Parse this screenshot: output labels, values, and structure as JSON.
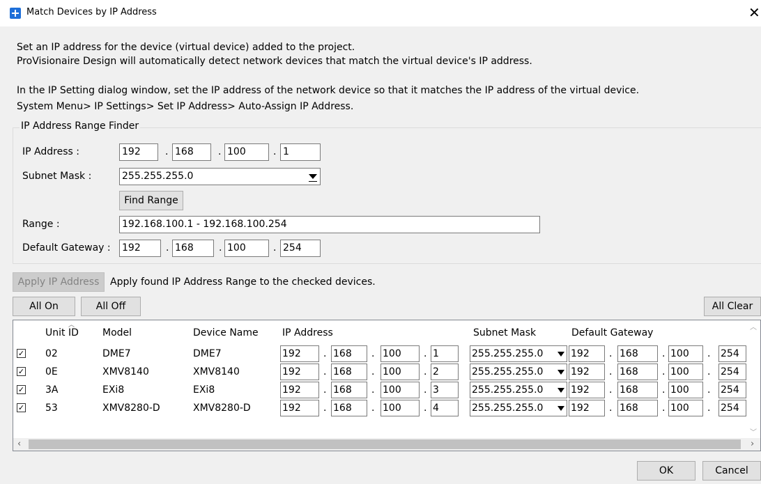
{
  "window": {
    "title": "Match Devices by IP Address",
    "close": "✕"
  },
  "description": {
    "line1": "Set an IP address for the device (virtual device) added to the project.",
    "line2": "ProVisionaire Design will automatically detect network devices that match the virtual device's IP address.",
    "line3": "In the IP Setting dialog window, set the IP address of the network device so that it matches the IP address of the virtual device.",
    "line4": "System Menu> IP Settings> Set IP Address> Auto-Assign IP Address."
  },
  "finder": {
    "title": "IP Address Range Finder",
    "ip_label": "IP Address :",
    "ip": [
      "192",
      "168",
      "100",
      "1"
    ],
    "subnet_label": "Subnet Mask :",
    "subnet": "255.255.255.0",
    "find_button": "Find Range",
    "range_label": "Range :",
    "range": "192.168.100.1 - 192.168.100.254",
    "gateway_label": "Default Gateway :",
    "gateway": [
      "192",
      "168",
      "100",
      "254"
    ]
  },
  "apply": {
    "button": "Apply IP Address",
    "text": "Apply found IP Address Range to the checked devices."
  },
  "buttons": {
    "all_on": "All On",
    "all_off": "All Off",
    "all_clear": "All Clear",
    "ok": "OK",
    "cancel": "Cancel"
  },
  "table": {
    "headers": [
      "Unit ID",
      "Model",
      "Device Name",
      "IP Address",
      "Subnet Mask",
      "Default Gateway"
    ],
    "rows": [
      {
        "checked": true,
        "unit_id": "02",
        "model": "DME7",
        "name": "DME7",
        "ip": [
          "192",
          "168",
          "100",
          "1"
        ],
        "subnet": "255.255.255.0",
        "gateway": [
          "192",
          "168",
          "100",
          "254"
        ]
      },
      {
        "checked": true,
        "unit_id": "0E",
        "model": "XMV8140",
        "name": "XMV8140",
        "ip": [
          "192",
          "168",
          "100",
          "2"
        ],
        "subnet": "255.255.255.0",
        "gateway": [
          "192",
          "168",
          "100",
          "254"
        ]
      },
      {
        "checked": true,
        "unit_id": "3A",
        "model": "EXi8",
        "name": "EXi8",
        "ip": [
          "192",
          "168",
          "100",
          "3"
        ],
        "subnet": "255.255.255.0",
        "gateway": [
          "192",
          "168",
          "100",
          "254"
        ]
      },
      {
        "checked": true,
        "unit_id": "53",
        "model": "XMV8280-D",
        "name": "XMV8280-D",
        "ip": [
          "192",
          "168",
          "100",
          "4"
        ],
        "subnet": "255.255.255.0",
        "gateway": [
          "192",
          "168",
          "100",
          "254"
        ]
      }
    ]
  },
  "colors": {
    "accent": "#1e6fd9",
    "background": "#f0f0f0"
  }
}
